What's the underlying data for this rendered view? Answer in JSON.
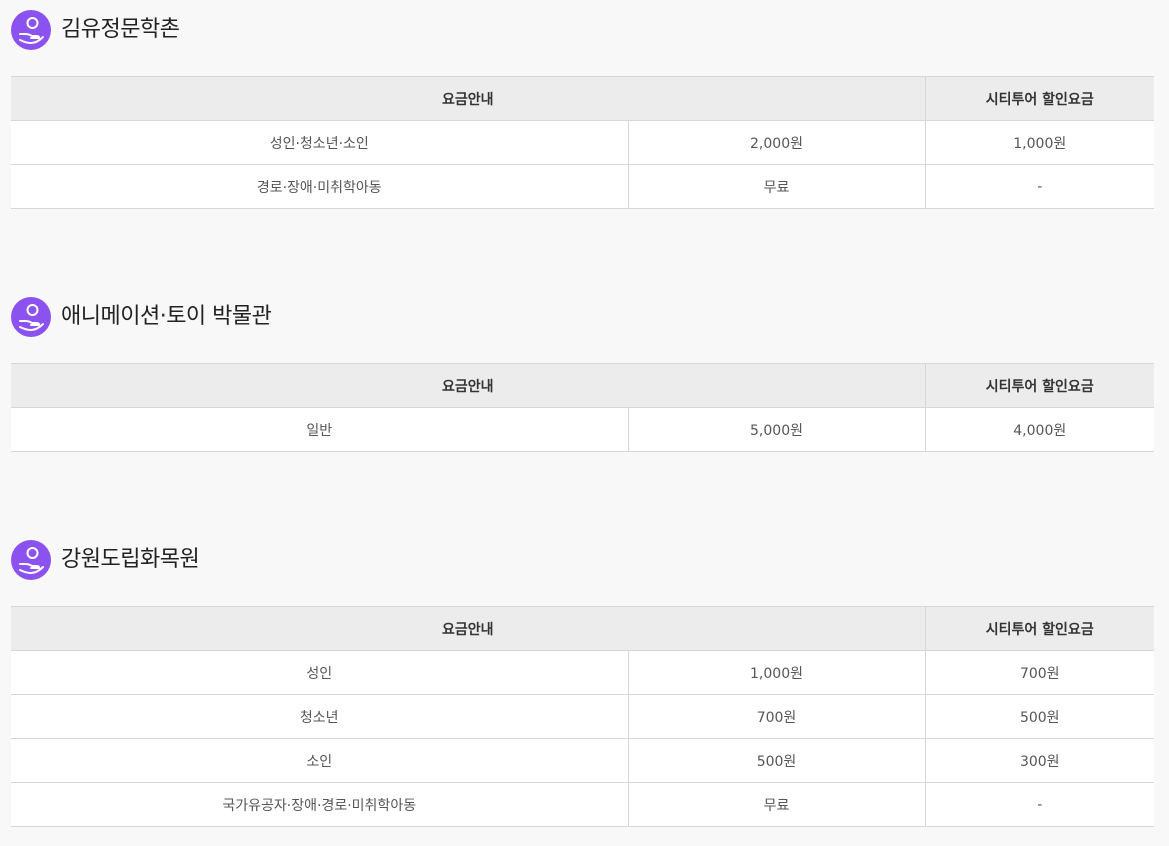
{
  "sections": [
    {
      "title": "김유정문학촌",
      "header": {
        "fee_label": "요금안내",
        "tour_label": "시티투어 할인요금"
      },
      "rows": [
        {
          "category": "성인·청소년·소인",
          "price": "2,000원",
          "tour_price": "1,000원"
        },
        {
          "category": "경로·장애·미취학아동",
          "price": "무료",
          "tour_price": "-"
        }
      ]
    },
    {
      "title": "애니메이션·토이 박물관",
      "header": {
        "fee_label": "요금안내",
        "tour_label": "시티투어 할인요금"
      },
      "rows": [
        {
          "category": "일반",
          "price": "5,000원",
          "tour_price": "4,000원"
        }
      ]
    },
    {
      "title": "강원도립화목원",
      "header": {
        "fee_label": "요금안내",
        "tour_label": "시티투어 할인요금"
      },
      "rows": [
        {
          "category": "성인",
          "price": "1,000원",
          "tour_price": "700원"
        },
        {
          "category": "청소년",
          "price": "700원",
          "tour_price": "500원"
        },
        {
          "category": "소인",
          "price": "500원",
          "tour_price": "300원"
        },
        {
          "category": "국가유공자·장애·경로·미취학아동",
          "price": "무료",
          "tour_price": "-"
        }
      ]
    }
  ],
  "icons": {
    "section_icon": "hand-holding-person-icon"
  },
  "colors": {
    "accent": "#8b52f0",
    "header_bg": "#ececec",
    "border": "#d6d6d6"
  }
}
